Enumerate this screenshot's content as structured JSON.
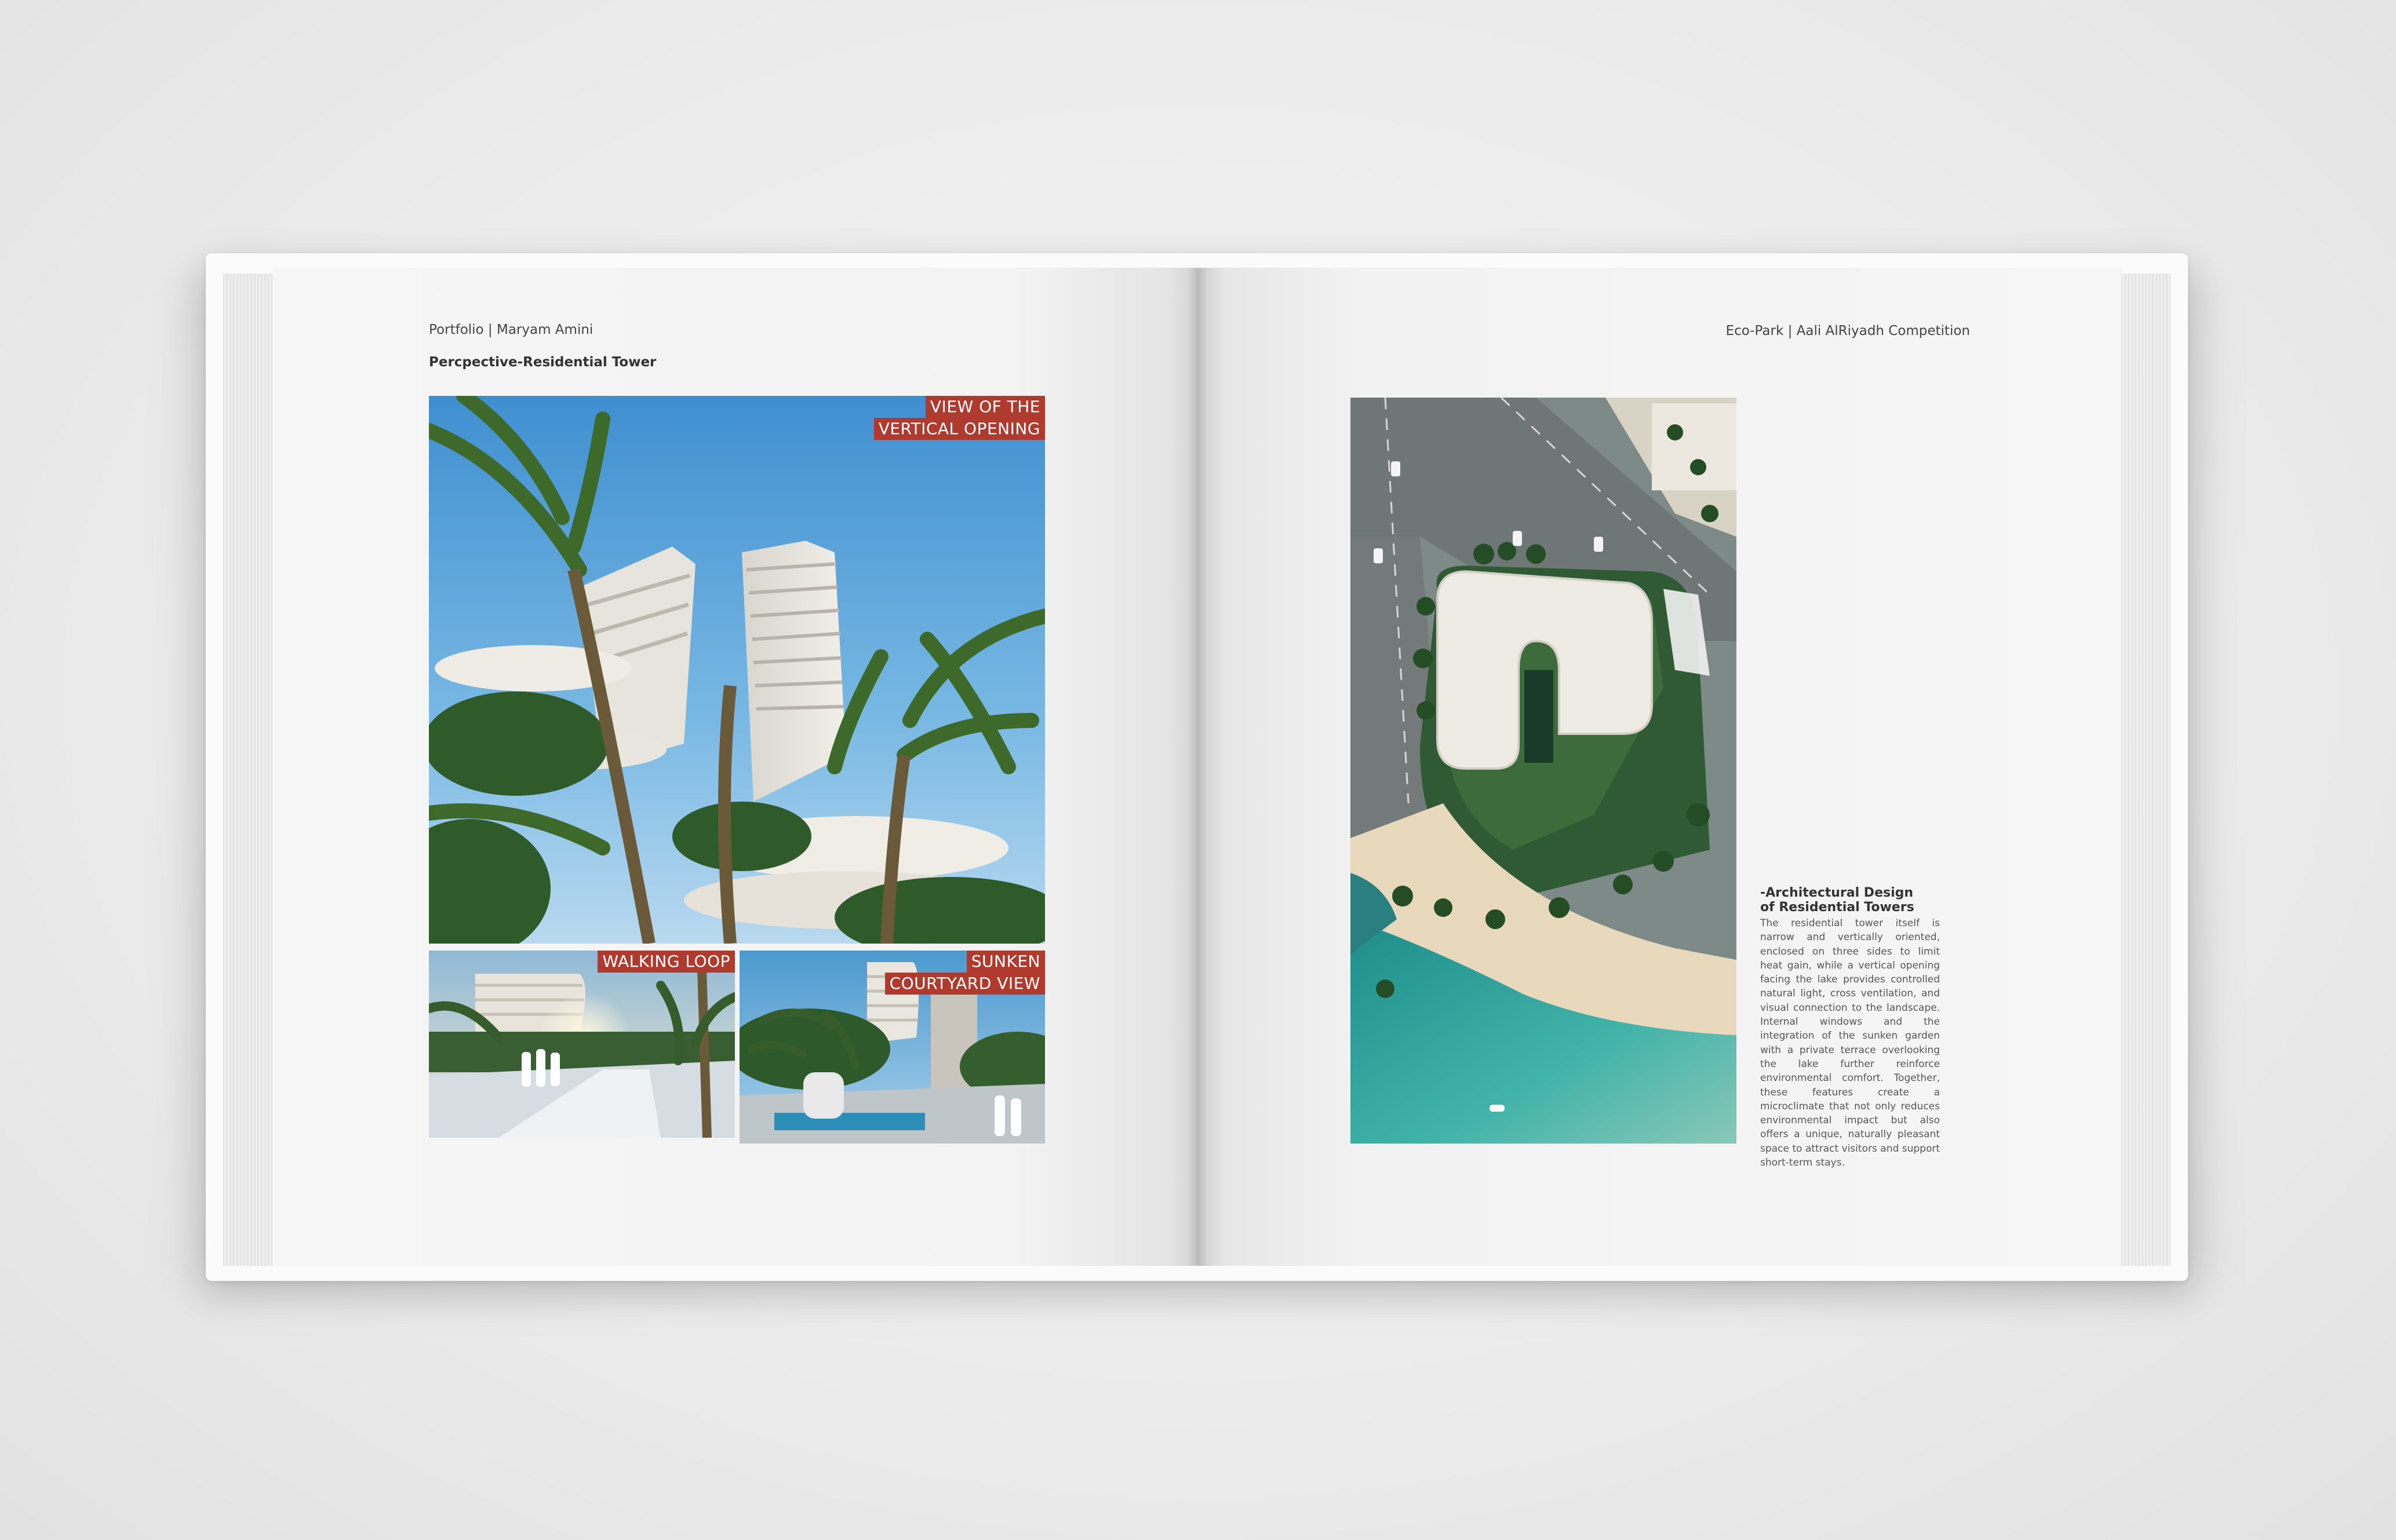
{
  "left_page": {
    "running_head": "Portfolio | Maryam Amini",
    "section_title": "Percpective-Residential Tower",
    "main_image": {
      "label_line1": "VIEW OF THE",
      "label_line2": "VERTICAL OPENING"
    },
    "bottom_left_image": {
      "label": "WALKING LOOP"
    },
    "bottom_right_image": {
      "label_line1": "SUNKEN",
      "label_line2": "COURTYARD VIEW"
    }
  },
  "right_page": {
    "running_head": "Eco-Park | Aali AlRiyadh Competition",
    "text_block": {
      "title_line1": "-Architectural Design",
      "title_line2": "of Residential Towers",
      "body": "The residential tower itself is narrow and vertically oriented, enclosed on three sides to limit heat gain, while a vertical opening facing the lake provides controlled natural light, cross ventilation, and visual connection to the landscape. Internal windows and the integration of the sunken garden with a private terrace overlooking the lake further reinforce environmental comfort. Together, these features create a microclimate that not only reduces environmental impact but also offers a unique, naturally pleasant space to attract visitors and support short-term stays."
    }
  },
  "colors": {
    "label_background": "#b03a2e",
    "label_text": "#ffffff",
    "page": "#f5f5f5",
    "background": "#ebebeb"
  }
}
